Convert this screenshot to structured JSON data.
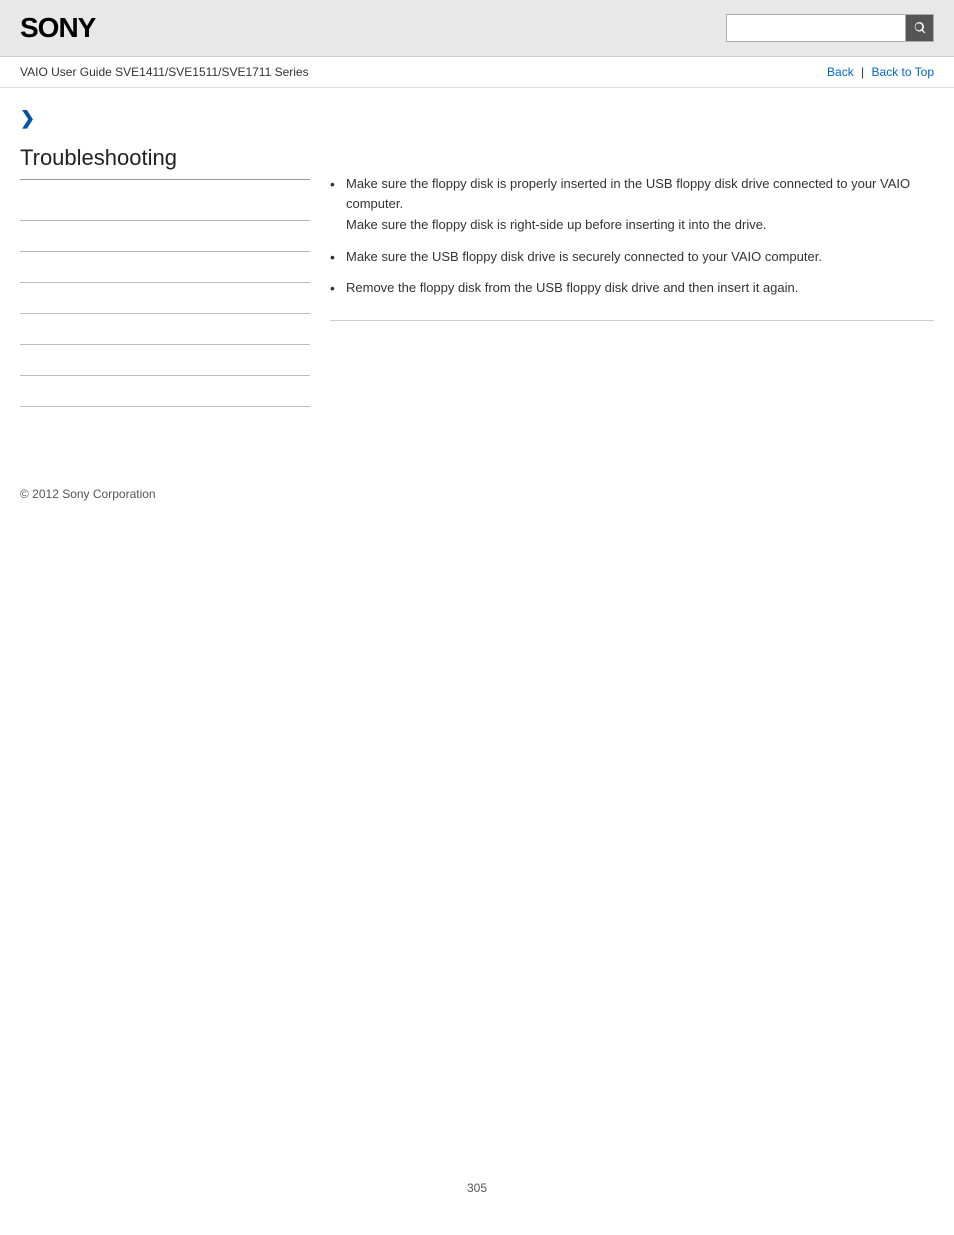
{
  "header": {
    "logo": "SONY",
    "search_placeholder": ""
  },
  "nav": {
    "guide_title": "VAIO User Guide SVE1411/SVE1511/SVE1711 Series",
    "back_label": "Back",
    "back_to_top_label": "Back to Top"
  },
  "sidebar": {
    "chevron": "❯",
    "section_title": "Troubleshooting",
    "links": [
      {
        "label": ""
      },
      {
        "label": ""
      },
      {
        "label": ""
      },
      {
        "label": ""
      },
      {
        "label": ""
      },
      {
        "label": ""
      },
      {
        "label": ""
      }
    ]
  },
  "content": {
    "bullet_items": [
      {
        "main": "Make sure the floppy disk is properly inserted in the USB floppy disk drive connected to your VAIO computer.",
        "sub": "Make sure the floppy disk is right-side up before inserting it into the drive."
      },
      {
        "main": "Make sure the USB floppy disk drive is securely connected to your VAIO computer.",
        "sub": ""
      },
      {
        "main": "Remove the floppy disk from the USB floppy disk drive and then insert it again.",
        "sub": ""
      }
    ]
  },
  "footer": {
    "copyright": "© 2012 Sony Corporation"
  },
  "page_number": "305"
}
